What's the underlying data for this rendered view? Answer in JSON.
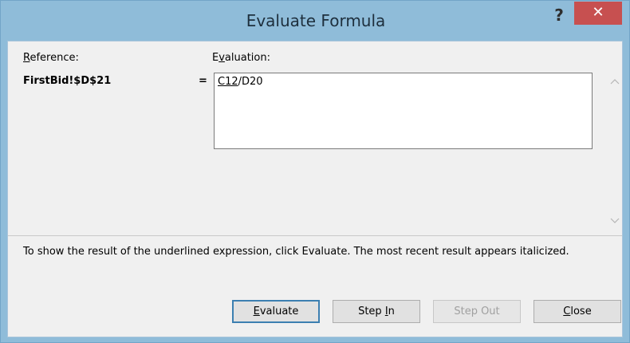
{
  "window": {
    "title": "Evaluate Formula",
    "help_glyph": "?",
    "close_glyph": "✕"
  },
  "reference": {
    "label_first": "R",
    "label_rest": "eference:",
    "value": "FirstBid!$D$21"
  },
  "evaluation": {
    "label_pre": "E",
    "label_u": "v",
    "label_rest": "aluation:",
    "equals": "=",
    "underlined_part": "C12",
    "rest_part": "/D20"
  },
  "scroll": {
    "up_glyph": "^",
    "down_glyph": "v"
  },
  "instruction": "To show the result of the underlined expression, click Evaluate.  The most recent result appears italicized.",
  "buttons": {
    "evaluate": {
      "u": "E",
      "rest": "valuate"
    },
    "step_in": {
      "pre": "Step ",
      "u": "I",
      "rest": "n"
    },
    "step_out": {
      "label": "Step Out"
    },
    "close": {
      "u": "C",
      "rest": "lose"
    }
  },
  "colors": {
    "titlebar": "#8fbcd9",
    "close_button": "#c75050",
    "client_bg": "#f0f0f0"
  }
}
